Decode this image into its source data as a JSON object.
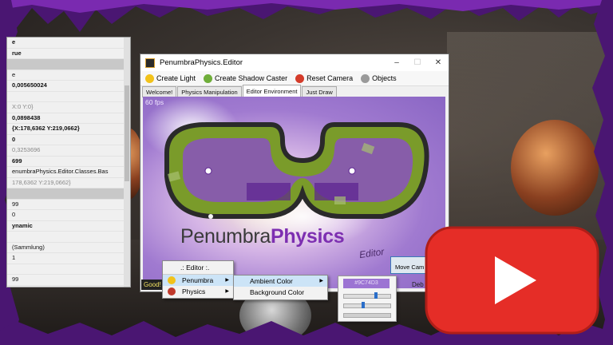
{
  "window": {
    "title": "PenumbraPhysics.Editor",
    "min": "–",
    "max": "☐",
    "close": "✕"
  },
  "toolbar": [
    {
      "name": "create-light-button",
      "label": "Create Light",
      "color": "#f2c21a"
    },
    {
      "name": "create-shadow-caster-button",
      "label": "Create Shadow Caster",
      "color": "#6fae3a"
    },
    {
      "name": "reset-camera-button",
      "label": "Reset Camera",
      "color": "#d43b2a"
    },
    {
      "name": "objects-button",
      "label": "Objects",
      "color": "#9a9a9a"
    }
  ],
  "tabs": [
    "Welcome!",
    "Physics Manipulation",
    "Editor Environment",
    "Just Draw"
  ],
  "active_tab": 2,
  "viewport": {
    "fps": "60 fps",
    "logo_light": "Penumbra",
    "logo_bold": "Physics",
    "logo_tag": "Editor",
    "move_camera": "Move Cam",
    "status_good": "Good!",
    "status_debug": "Deb"
  },
  "properties": [
    {
      "t": "e",
      "s": "bold"
    },
    {
      "t": "rue",
      "s": "bold"
    },
    {
      "t": "",
      "s": "sel"
    },
    {
      "t": "e",
      "s": ""
    },
    {
      "t": "0,005650024",
      "s": "bold"
    },
    {
      "t": "",
      "s": ""
    },
    {
      "t": "X:0 Y:0}",
      "s": "grey"
    },
    {
      "t": "0,0898438",
      "s": "bold"
    },
    {
      "t": "{X:178,6362 Y:219,0662}",
      "s": "bold"
    },
    {
      "t": "0",
      "s": "bold"
    },
    {
      "t": "0,3253696",
      "s": "grey"
    },
    {
      "t": "699",
      "s": "bold"
    },
    {
      "t": "enumbraPhysics.Editor.Classes.Bas",
      "s": ""
    },
    {
      "t": "178,6362 Y:219,0662}",
      "s": "grey"
    },
    {
      "t": "",
      "s": "sel"
    },
    {
      "t": "99",
      "s": ""
    },
    {
      "t": "0",
      "s": ""
    },
    {
      "t": "ynamic",
      "s": "bold"
    },
    {
      "t": "",
      "s": ""
    },
    {
      "t": "(Sammlung)",
      "s": ""
    },
    {
      "t": "1",
      "s": ""
    },
    {
      "t": "",
      "s": ""
    },
    {
      "t": "99",
      "s": ""
    }
  ],
  "menu_main": {
    "header": ".: Editor :.",
    "items": [
      {
        "label": "Penumbra",
        "icon": "bulb-icon",
        "color": "#f2c21a"
      },
      {
        "label": "Physics",
        "icon": "physics-icon",
        "color": "#c0392b"
      }
    ]
  },
  "menu_sub": [
    "Ambient Color",
    "Background Color"
  ],
  "color_picker": {
    "hex": "#9C74D3",
    "slider1": 0.7,
    "slider2": 0.4
  },
  "colors": {
    "accent": "#7d2fb1",
    "highlight": "#cce4f7",
    "vine": "#5a1a8a",
    "youtube": "#e52d27"
  }
}
